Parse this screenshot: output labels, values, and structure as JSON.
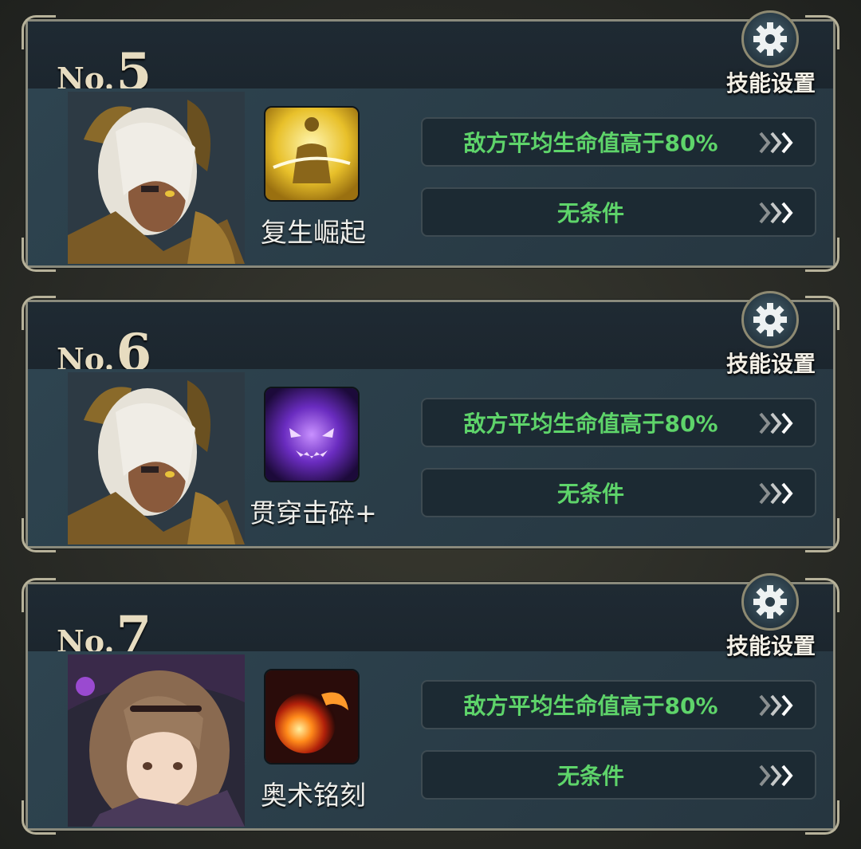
{
  "slots": [
    {
      "number_prefix": "No.",
      "number": "5",
      "settings_label": "技能设置",
      "gear_icon": "gear-icon",
      "character_portrait": "white-haired-armored-warrior",
      "skill_icon": "golden-rising-figure",
      "skill_name": "复生崛起",
      "conditions": [
        "敌方平均生命值高于80%",
        "无条件"
      ]
    },
    {
      "number_prefix": "No.",
      "number": "6",
      "settings_label": "技能设置",
      "gear_icon": "gear-icon",
      "character_portrait": "white-haired-armored-warrior",
      "skill_icon": "purple-shadow-face",
      "skill_name": "贯穿击碎+",
      "conditions": [
        "敌方平均生命值高于80%",
        "无条件"
      ]
    },
    {
      "number_prefix": "No.",
      "number": "7",
      "settings_label": "技能设置",
      "gear_icon": "gear-icon",
      "character_portrait": "brown-haired-witch",
      "skill_icon": "fire-comet",
      "skill_name": "奥术铭刻",
      "conditions": [
        "敌方平均生命值高于80%",
        "无条件"
      ]
    }
  ],
  "colors": {
    "condition_text": "#5ed46a",
    "number_text": "#e7dcc0",
    "frame": "#8a8a7c"
  }
}
